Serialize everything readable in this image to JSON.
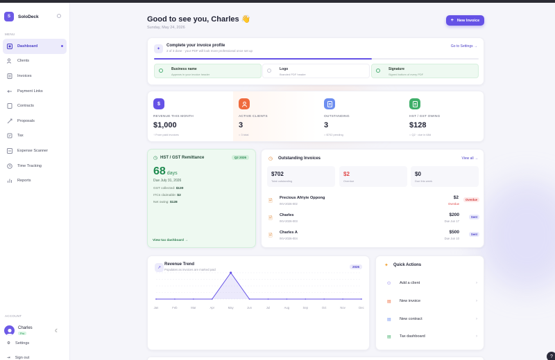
{
  "sidebar": {
    "brand": {
      "initial": "S",
      "name": "SoloDeck"
    },
    "menu_label": "MENU",
    "items": [
      {
        "label": "Dashboard"
      },
      {
        "label": "Clients"
      },
      {
        "label": "Invoices"
      },
      {
        "label": "Payment Links"
      },
      {
        "label": "Contracts"
      },
      {
        "label": "Proposals"
      },
      {
        "label": "Tax"
      },
      {
        "label": "Expense Scanner"
      },
      {
        "label": "Time Tracking"
      },
      {
        "label": "Reports"
      }
    ],
    "account_label": "ACCOUNT",
    "user": {
      "name": "Charles",
      "plan": "Pro"
    },
    "settings_label": "Settings",
    "signout_label": "Sign out"
  },
  "header": {
    "greeting": "Good to see you, Charles 👋",
    "date": "Sunday, May 24, 2026",
    "new_invoice_label": "New Invoice"
  },
  "profile": {
    "title": "Complete your invoice profile",
    "subtitle": "2 of 3 done · your PDF will look more professional once set up",
    "link": "Go to Settings →",
    "progress_fraction": 0.67,
    "steps": [
      {
        "title": "Business name",
        "sub": "Appears in your invoice header",
        "done": true
      },
      {
        "title": "Logo",
        "sub": "Branded PDF header",
        "done": false
      },
      {
        "title": "Signature",
        "sub": "Signed bottom of every PDF",
        "done": true
      }
    ]
  },
  "stats": [
    {
      "icon": "$",
      "label": "REVENUE THIS MONTH",
      "value": "$1,000",
      "sub": "↑ From paid invoices",
      "color": "#6552e6"
    },
    {
      "icon": "person",
      "label": "ACTIVE CLIENTS",
      "value": "3",
      "sub": "○ 3 total",
      "color": "#ef6b3d"
    },
    {
      "icon": "doc",
      "label": "OUTSTANDING",
      "value": "3",
      "sub": "○ $702 pending",
      "color": "#6d8ef0"
    },
    {
      "icon": "doc",
      "label": "HST / GST OWING",
      "value": "$128",
      "sub": "○ Q2 · due in 68d",
      "color": "#3fae69"
    }
  ],
  "hst": {
    "title": "HST / GST Remittance",
    "quarter": "Q2 2026",
    "days": "68",
    "days_unit": "days",
    "due": "Due July 31, 2026",
    "lines": [
      {
        "label": "GST collected:",
        "value": "$130"
      },
      {
        "label": "ITCs claimable:",
        "value": "$2"
      },
      {
        "label": "Net owing:",
        "value": "$128"
      }
    ],
    "link": "View tax dashboard →"
  },
  "outstanding": {
    "title": "Outstanding Invoices",
    "view_all": "View all →",
    "summary": [
      {
        "value": "$702",
        "label": "Total outstanding",
        "color": "#1f2133"
      },
      {
        "value": "$2",
        "label": "Overdue",
        "color": "#e04a4a"
      },
      {
        "value": "$0",
        "label": "Due this week",
        "color": "#1f2133"
      }
    ],
    "invoices": [
      {
        "name": "Precious Afriyie Oppong",
        "id": "INV-2026-002",
        "amount": "$2",
        "due": "Overdue",
        "status": "Overdue"
      },
      {
        "name": "Charles",
        "id": "INV-2026-003",
        "amount": "$200",
        "due": "Due Jun 17",
        "status": "Sent"
      },
      {
        "name": "Charles A",
        "id": "INV-2026-004",
        "amount": "$500",
        "due": "Due Jun 10",
        "status": "Sent"
      }
    ]
  },
  "trend": {
    "title": "Revenue Trend",
    "subtitle": "Populates as invoices are marked paid",
    "year": "2026"
  },
  "chart_data": {
    "type": "area",
    "title": "Revenue Trend",
    "x": [
      "Jan",
      "Feb",
      "Mar",
      "Apr",
      "May",
      "Jun",
      "Jul",
      "Aug",
      "Sep",
      "Oct",
      "Nov",
      "Dec"
    ],
    "values": [
      0,
      0,
      0,
      0,
      1000,
      0,
      0,
      0,
      0,
      0,
      0,
      0
    ],
    "ylim": [
      0,
      1000
    ],
    "grid": true,
    "color": "#6552e6"
  },
  "quick_actions": {
    "title": "Quick Actions",
    "items": [
      {
        "label": "Add a client",
        "icon": "person-icon",
        "color": "#6552e6"
      },
      {
        "label": "New invoice",
        "icon": "doc-icon",
        "color": "#ef6b3d"
      },
      {
        "label": "New contract",
        "icon": "doc-icon",
        "color": "#6d8ef0"
      },
      {
        "label": "Tax dashboard",
        "icon": "doc-icon",
        "color": "#3fae69"
      }
    ]
  }
}
